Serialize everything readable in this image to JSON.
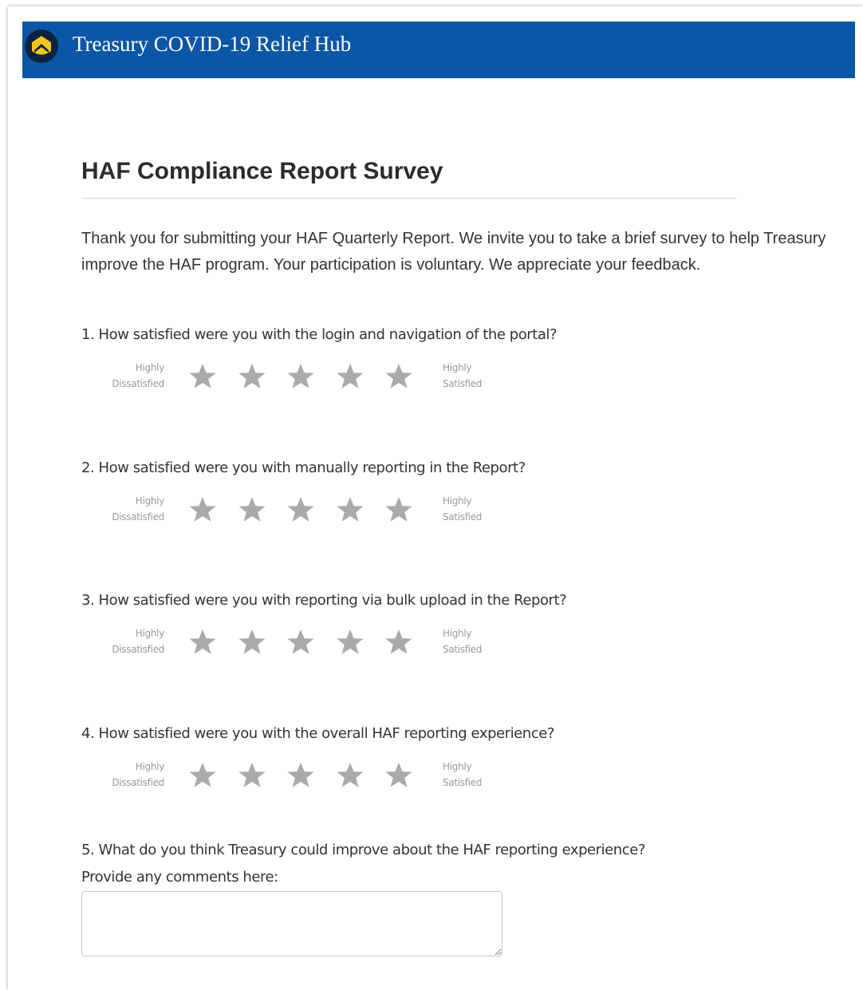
{
  "header": {
    "site_title": "Treasury COVID-19 Relief Hub",
    "logo_icon": "treasury-shield-icon",
    "background_color": "#0b56a6"
  },
  "survey": {
    "title": "HAF Compliance Report Survey",
    "intro": "Thank you for submitting your HAF Quarterly Report. We invite you to take a brief survey to help Treasury improve the HAF program. Your participation is voluntary. We appreciate your feedback.",
    "scale_low_line1": "Highly",
    "scale_low_line2": "Dissatisfied",
    "scale_high_line1": "Highly",
    "scale_high_line2": "Satisfied",
    "star_icon": "star-icon",
    "star_color": "#aaaaaa",
    "questions": [
      {
        "text": "1. How satisfied were you with the login and navigation of the portal?",
        "rating": 0,
        "max_rating": 5
      },
      {
        "text": "2. How satisfied were you with manually reporting in the Report?",
        "rating": 0,
        "max_rating": 5
      },
      {
        "text": "3. How satisfied were you with reporting via bulk upload in the Report?",
        "rating": 0,
        "max_rating": 5
      },
      {
        "text": "4. How satisfied were you with the overall HAF reporting experience?",
        "rating": 0,
        "max_rating": 5
      }
    ],
    "open_question": {
      "text": "5. What do you think Treasury could improve about the HAF reporting experience?",
      "label": "Provide any comments here:",
      "value": ""
    }
  }
}
